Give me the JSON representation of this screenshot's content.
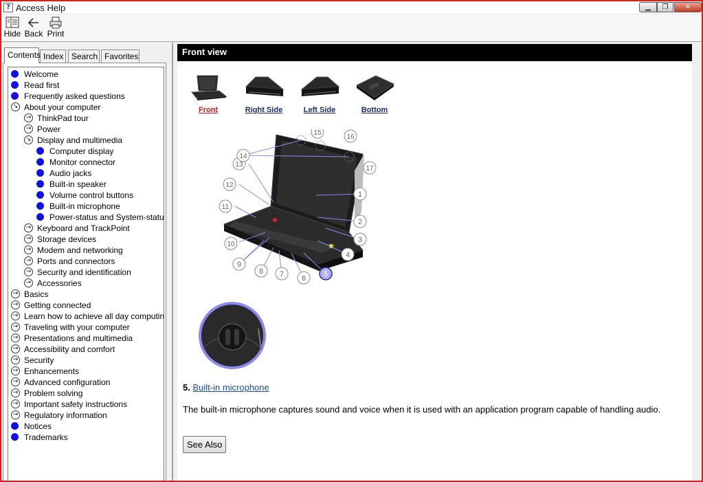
{
  "window": {
    "title": "Access Help",
    "icon_name": "help-book-icon",
    "controls": {
      "minimize": "minimize-icon",
      "maximize": "maximize-icon",
      "close": "close-icon"
    }
  },
  "toolbar": {
    "hide_label": "Hide",
    "back_label": "Back",
    "print_label": "Print"
  },
  "tabs": [
    {
      "label": "Contents",
      "active": true
    },
    {
      "label": "Index"
    },
    {
      "label": "Search"
    },
    {
      "label": "Favorites"
    }
  ],
  "tree": [
    {
      "label": "Welcome",
      "type": "topic",
      "level": 0
    },
    {
      "label": "Read first",
      "type": "topic",
      "level": 0
    },
    {
      "label": "Frequently asked questions",
      "type": "topic",
      "level": 0
    },
    {
      "label": "About your computer",
      "type": "expanded",
      "level": 0
    },
    {
      "label": "ThinkPad tour",
      "type": "collapsed",
      "level": 1
    },
    {
      "label": "Power",
      "type": "collapsed",
      "level": 1
    },
    {
      "label": "Display and multimedia",
      "type": "expanded",
      "level": 1
    },
    {
      "label": "Computer display",
      "type": "topic",
      "level": 2
    },
    {
      "label": "Monitor connector",
      "type": "topic",
      "level": 2
    },
    {
      "label": "Audio jacks",
      "type": "topic",
      "level": 2
    },
    {
      "label": "Built-in speaker",
      "type": "topic",
      "level": 2
    },
    {
      "label": "Volume control buttons",
      "type": "topic",
      "level": 2
    },
    {
      "label": "Built-in microphone",
      "type": "topic",
      "level": 2
    },
    {
      "label": "Power-status and System-status inc",
      "type": "topic",
      "level": 2
    },
    {
      "label": "Keyboard and TrackPoint",
      "type": "collapsed",
      "level": 1
    },
    {
      "label": "Storage devices",
      "type": "collapsed",
      "level": 1
    },
    {
      "label": "Modem and networking",
      "type": "collapsed",
      "level": 1
    },
    {
      "label": "Ports and connectors",
      "type": "collapsed",
      "level": 1
    },
    {
      "label": "Security and identification",
      "type": "collapsed",
      "level": 1
    },
    {
      "label": "Accessories",
      "type": "collapsed",
      "level": 1
    },
    {
      "label": "Basics",
      "type": "collapsed",
      "level": 0
    },
    {
      "label": "Getting connected",
      "type": "collapsed",
      "level": 0
    },
    {
      "label": "Learn how to achieve all day computing",
      "type": "collapsed",
      "level": 0
    },
    {
      "label": "Traveling with your computer",
      "type": "collapsed",
      "level": 0
    },
    {
      "label": "Presentations and multimedia",
      "type": "collapsed",
      "level": 0
    },
    {
      "label": "Accessibility and comfort",
      "type": "collapsed",
      "level": 0
    },
    {
      "label": "Security",
      "type": "collapsed",
      "level": 0
    },
    {
      "label": "Enhancements",
      "type": "collapsed",
      "level": 0
    },
    {
      "label": "Advanced configuration",
      "type": "collapsed",
      "level": 0
    },
    {
      "label": "Problem solving",
      "type": "collapsed",
      "level": 0
    },
    {
      "label": "Important safety instructions",
      "type": "collapsed",
      "level": 0
    },
    {
      "label": "Regulatory information",
      "type": "collapsed",
      "level": 0
    },
    {
      "label": "Notices",
      "type": "topic",
      "level": 0
    },
    {
      "label": "Trademarks",
      "type": "topic",
      "level": 0
    }
  ],
  "content": {
    "heading": "Front view",
    "views": [
      {
        "label": "Front",
        "selected": true
      },
      {
        "label": "Right Side"
      },
      {
        "label": "Left Side"
      },
      {
        "label": "Bottom"
      }
    ],
    "callouts": [
      "1",
      "2",
      "3",
      "4",
      "5",
      "6",
      "7",
      "8",
      "9",
      "10",
      "11",
      "12",
      "13",
      "14",
      "15",
      "16",
      "17"
    ],
    "highlighted_callout": "5",
    "item_number": "5.",
    "item_link": "Built-in microphone",
    "description": "The built-in microphone captures sound and voice when it is used with an application program capable of handling audio.",
    "see_also_label": "See Also"
  },
  "colors": {
    "topic_dot": "#1010e8",
    "selected_view": "#d01a1a",
    "link": "#1a4aa0",
    "heading_bar": "#000000",
    "callout_highlight": "#b0b0f0",
    "window_border": "#d81f1f"
  }
}
